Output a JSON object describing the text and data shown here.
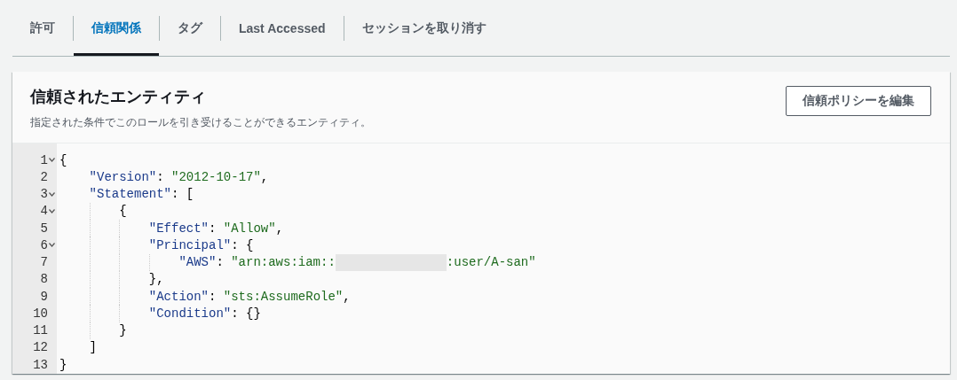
{
  "tabs": [
    {
      "label": "許可",
      "selected": false
    },
    {
      "label": "信頼関係",
      "selected": true
    },
    {
      "label": "タグ",
      "selected": false
    },
    {
      "label": "Last Accessed",
      "selected": false
    },
    {
      "label": "セッションを取り消す",
      "selected": false
    }
  ],
  "panel": {
    "title": "信頼されたエンティティ",
    "description": "指定された条件でこのロールを引き受けることができるエンティティ。",
    "edit_button": "信頼ポリシーを編集",
    "code_lines": [
      {
        "number": "1",
        "foldable": true,
        "tokens": [
          {
            "kind": "punct",
            "text": "{"
          }
        ],
        "children": [
          {
            "number": "2",
            "foldable": false,
            "tokens": [
              {
                "kind": "key",
                "text": "\"Version\""
              },
              {
                "kind": "punct",
                "text": ": "
              },
              {
                "kind": "string",
                "text": "\"2012-10-17\""
              },
              {
                "kind": "punct",
                "text": ","
              }
            ]
          },
          {
            "number": "3",
            "foldable": true,
            "tokens": [
              {
                "kind": "key",
                "text": "\"Statement\""
              },
              {
                "kind": "punct",
                "text": ": ["
              }
            ],
            "children": [
              {
                "number": "4",
                "foldable": true,
                "tokens": [
                  {
                    "kind": "punct",
                    "text": "{"
                  }
                ],
                "children": [
                  {
                    "number": "5",
                    "foldable": false,
                    "tokens": [
                      {
                        "kind": "key",
                        "text": "\"Effect\""
                      },
                      {
                        "kind": "punct",
                        "text": ": "
                      },
                      {
                        "kind": "string",
                        "text": "\"Allow\""
                      },
                      {
                        "kind": "punct",
                        "text": ","
                      }
                    ]
                  },
                  {
                    "number": "6",
                    "foldable": true,
                    "tokens": [
                      {
                        "kind": "key",
                        "text": "\"Principal\""
                      },
                      {
                        "kind": "punct",
                        "text": ": {"
                      }
                    ],
                    "children": [
                      {
                        "number": "7",
                        "foldable": false,
                        "tokens": [
                          {
                            "kind": "key",
                            "text": "\"AWS\""
                          },
                          {
                            "kind": "punct",
                            "text": ": "
                          },
                          {
                            "kind": "string",
                            "text": "\"arn:aws:iam::"
                          },
                          {
                            "kind": "redaction"
                          },
                          {
                            "kind": "string",
                            "text": ":user/A-san\""
                          }
                        ]
                      }
                    ]
                  },
                  {
                    "number": "8",
                    "foldable": false,
                    "tokens": [
                      {
                        "kind": "punct",
                        "text": "},"
                      }
                    ]
                  },
                  {
                    "number": "9",
                    "foldable": false,
                    "tokens": [
                      {
                        "kind": "key",
                        "text": "\"Action\""
                      },
                      {
                        "kind": "punct",
                        "text": ": "
                      },
                      {
                        "kind": "string",
                        "text": "\"sts:AssumeRole\""
                      },
                      {
                        "kind": "punct",
                        "text": ","
                      }
                    ]
                  },
                  {
                    "number": "10",
                    "foldable": false,
                    "tokens": [
                      {
                        "kind": "key",
                        "text": "\"Condition\""
                      },
                      {
                        "kind": "punct",
                        "text": ": {}"
                      }
                    ]
                  }
                ]
              },
              {
                "number": "11",
                "foldable": false,
                "tokens": [
                  {
                    "kind": "punct",
                    "text": "}"
                  }
                ]
              }
            ]
          },
          {
            "number": "12",
            "foldable": false,
            "tokens": [
              {
                "kind": "punct",
                "text": "]"
              }
            ]
          }
        ]
      },
      {
        "number": "13",
        "foldable": false,
        "tokens": [
          {
            "kind": "punct",
            "text": "}"
          }
        ]
      }
    ]
  }
}
